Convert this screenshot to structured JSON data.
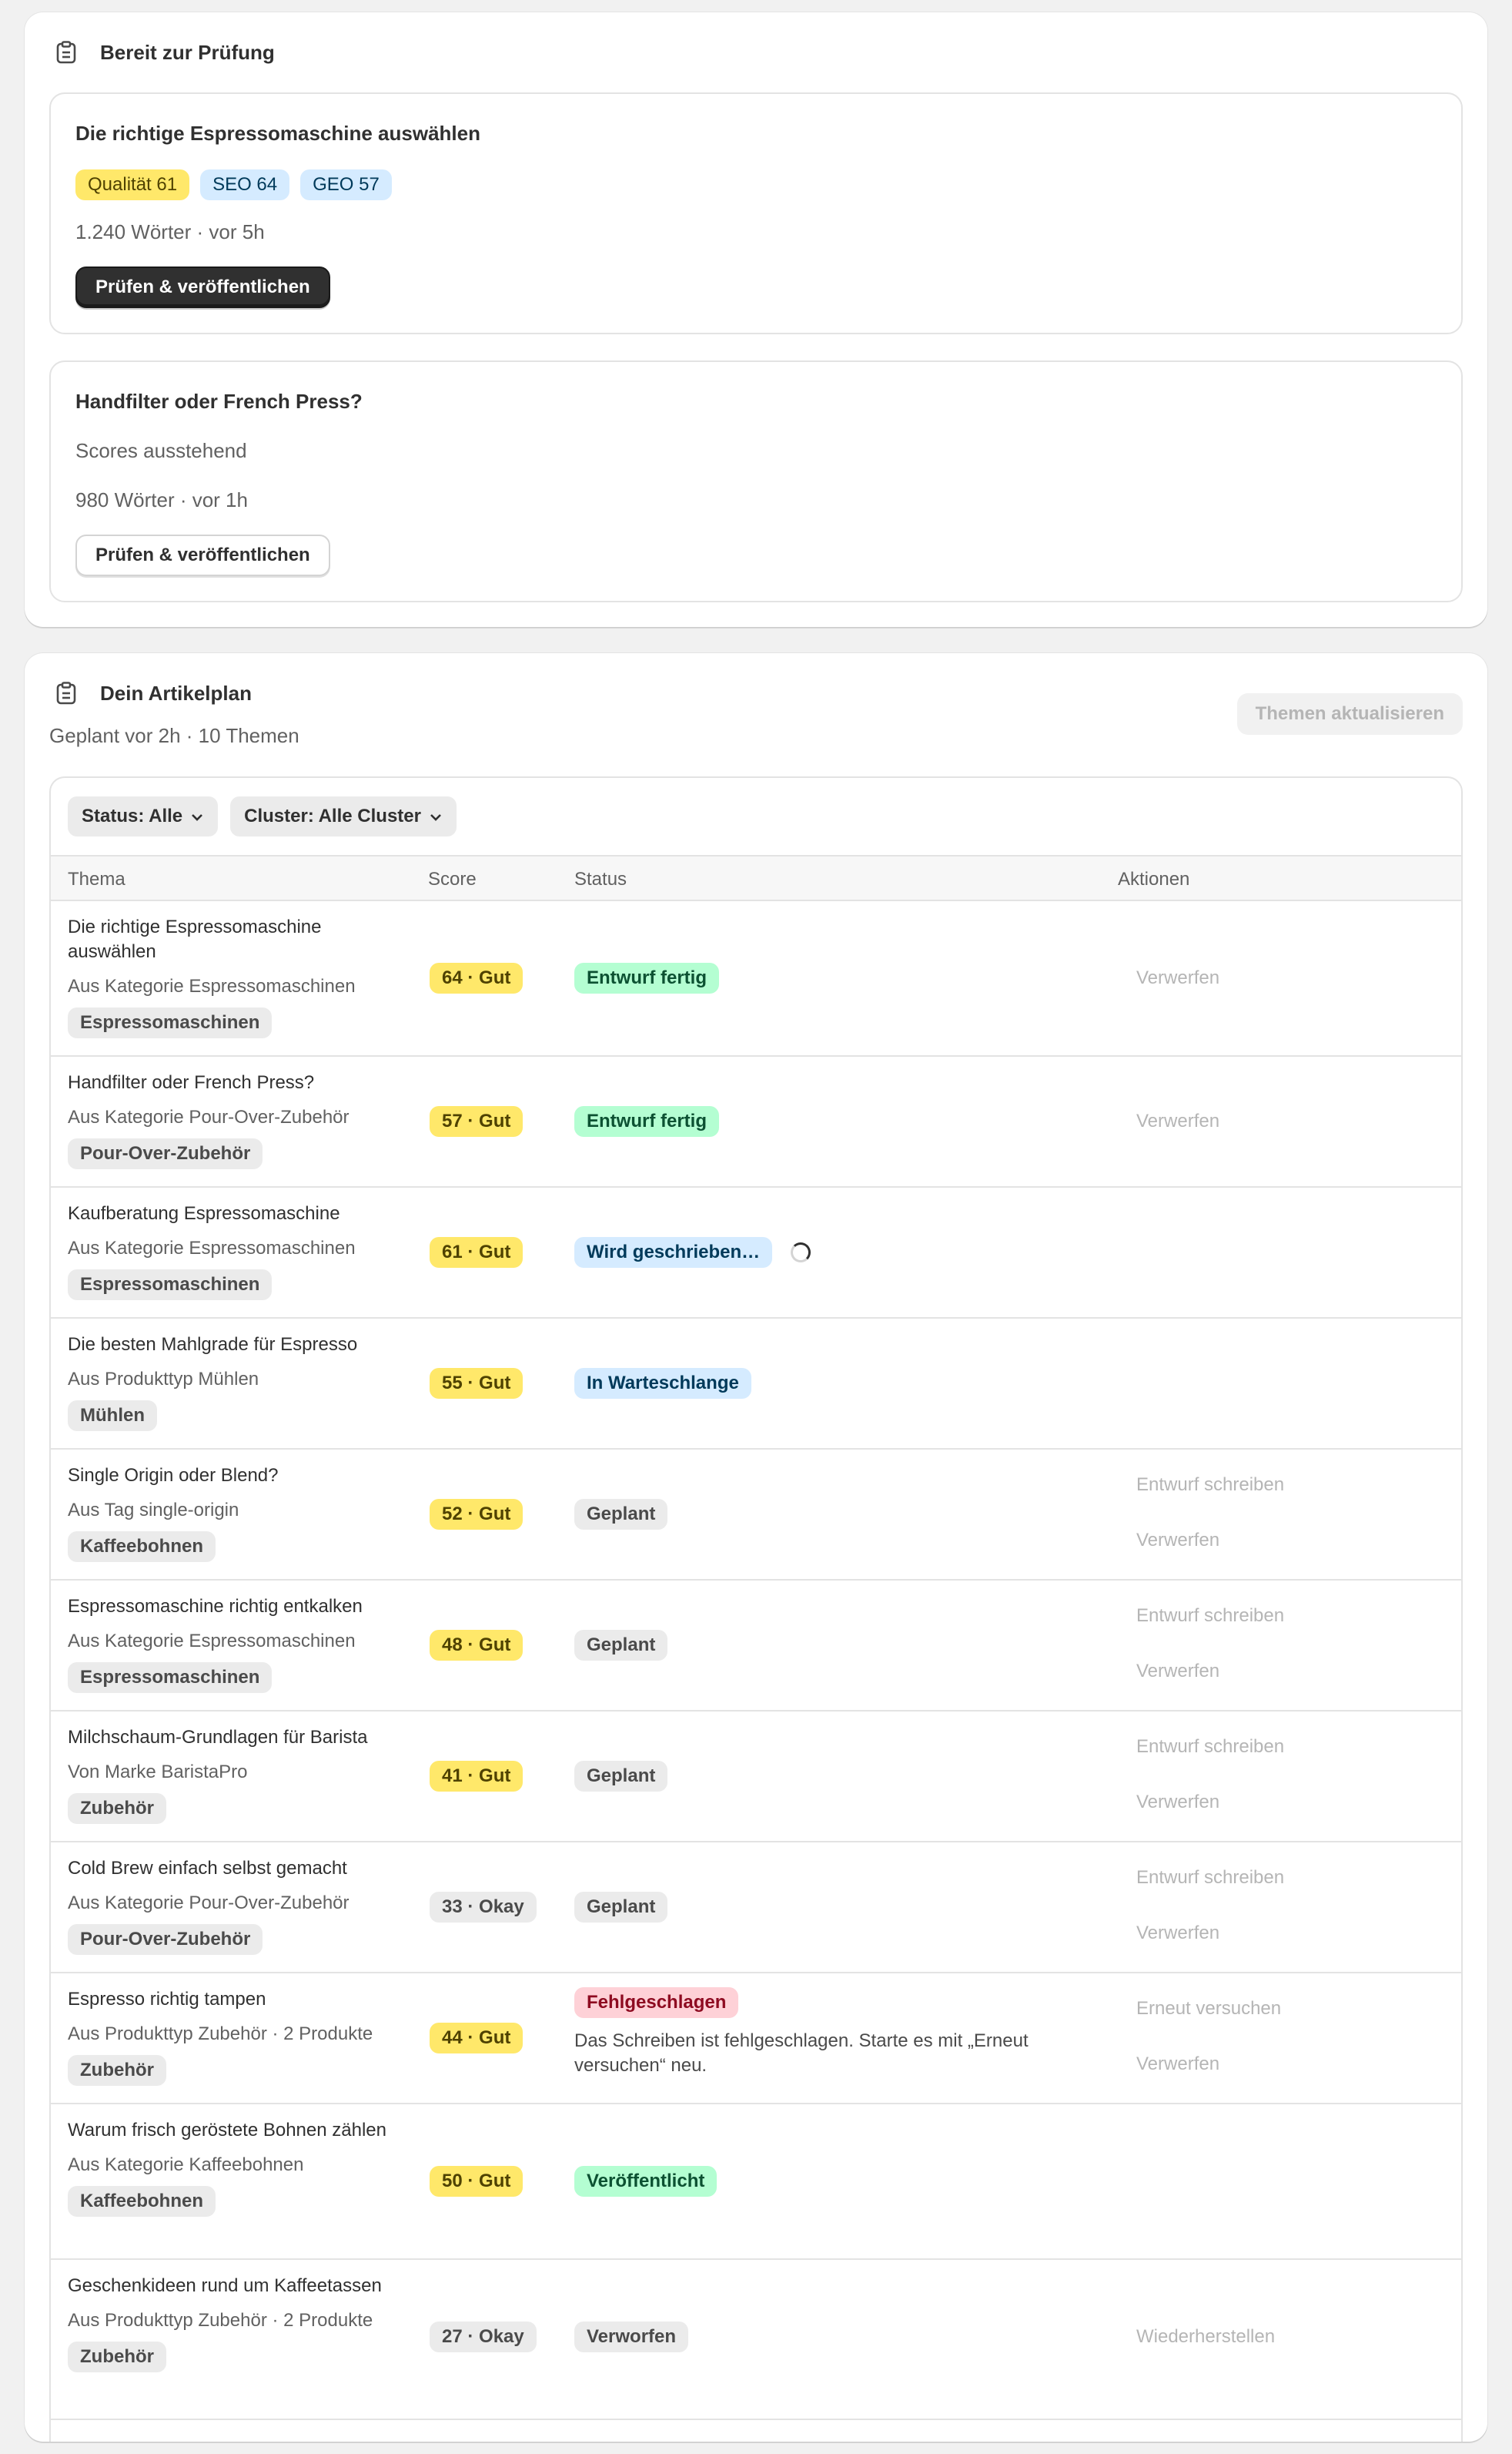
{
  "review": {
    "title": "Bereit zur Prüfung",
    "articles": [
      {
        "title": "Die richtige Espressomaschine auswählen",
        "badges": [
          "Qualität 61",
          "SEO 64",
          "GEO 57"
        ],
        "meta": "1.240 Wörter · vor 5h",
        "button": "Prüfen & veröffentlichen"
      },
      {
        "title": "Handfilter oder French Press?",
        "scores_text": "Scores ausstehend",
        "meta": "980 Wörter · vor 1h",
        "button": "Prüfen & veröffentlichen"
      }
    ]
  },
  "plan": {
    "title": "Dein Artikelplan",
    "subtitle": "Geplant vor 2h · 10 Themen",
    "refresh_button": "Themen aktualisieren",
    "filters": [
      "Status: Alle",
      "Cluster: Alle Cluster"
    ],
    "columns": [
      "Thema",
      "Score",
      "Status",
      "Aktionen"
    ],
    "rows": [
      {
        "title": "Die richtige Espressomaschine auswählen",
        "source": "Aus Kategorie Espressomaschinen",
        "tag": "Espressomaschinen",
        "score": "64 · Gut",
        "status": "Entwurf fertig",
        "actions": [
          "Verwerfen"
        ]
      },
      {
        "title": "Handfilter oder French Press?",
        "source": "Aus Kategorie Pour-Over-Zubehör",
        "tag": "Pour-Over-Zubehör",
        "score": "57 · Gut",
        "status": "Entwurf fertig",
        "actions": [
          "Verwerfen"
        ]
      },
      {
        "title": "Kaufberatung Espressomaschine",
        "source": "Aus Kategorie Espressomaschinen",
        "tag": "Espressomaschinen",
        "score": "61 · Gut",
        "status": "Wird geschrieben…",
        "actions": []
      },
      {
        "title": "Die besten Mahlgrade für Espresso",
        "source": "Aus Produkttyp Mühlen",
        "tag": "Mühlen",
        "score": "55 · Gut",
        "status": "In Warteschlange",
        "actions": []
      },
      {
        "title": "Single Origin oder Blend?",
        "source": "Aus Tag single-origin",
        "tag": "Kaffeebohnen",
        "score": "52 · Gut",
        "status": "Geplant",
        "actions": [
          "Entwurf schreiben",
          "Verwerfen"
        ]
      },
      {
        "title": "Espressomaschine richtig entkalken",
        "source": "Aus Kategorie Espressomaschinen",
        "tag": "Espressomaschinen",
        "score": "48 · Gut",
        "status": "Geplant",
        "actions": [
          "Entwurf schreiben",
          "Verwerfen"
        ]
      },
      {
        "title": "Milchschaum-Grundlagen für Barista",
        "source": "Von Marke BaristaPro",
        "tag": "Zubehör",
        "score": "41 · Gut",
        "status": "Geplant",
        "actions": [
          "Entwurf schreiben",
          "Verwerfen"
        ]
      },
      {
        "title": "Cold Brew einfach selbst gemacht",
        "source": "Aus Kategorie Pour-Over-Zubehör",
        "tag": "Pour-Over-Zubehör",
        "score": "33 · Okay",
        "status": "Geplant",
        "actions": [
          "Entwurf schreiben",
          "Verwerfen"
        ]
      },
      {
        "title": "Espresso richtig tampen",
        "source": "Aus Produkttyp Zubehör · 2 Produkte",
        "tag": "Zubehör",
        "score": "44 · Gut",
        "status": "Fehlgeschlagen",
        "error": "Das Schreiben ist fehlgeschlagen. Starte es mit „Erneut versuchen“ neu.",
        "actions": [
          "Erneut versuchen",
          "Verwerfen"
        ]
      },
      {
        "title": "Warum frisch geröstete Bohnen zählen",
        "source": "Aus Kategorie Kaffeebohnen",
        "tag": "Kaffeebohnen",
        "score": "50 · Gut",
        "status": "Veröffentlicht",
        "actions": []
      },
      {
        "title": "Geschenkideen rund um Kaffeetassen",
        "source": "Aus Produkttyp Zubehör · 2 Produkte",
        "tag": "Zubehör",
        "score": "27 · Okay",
        "status": "Verworfen",
        "actions": [
          "Wiederherstellen"
        ]
      }
    ]
  }
}
